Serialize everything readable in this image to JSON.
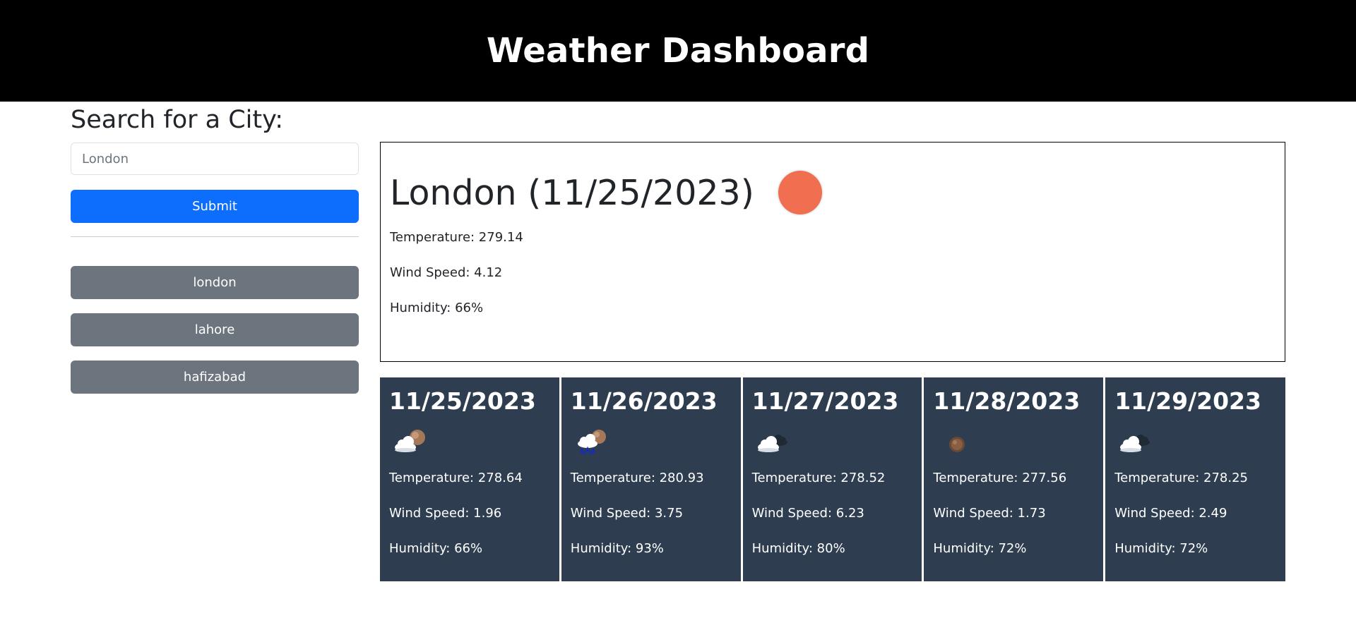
{
  "header": {
    "title": "Weather Dashboard"
  },
  "search": {
    "title": "Search for a City:",
    "value": "London",
    "placeholder": "London",
    "submit_label": "Submit"
  },
  "history": [
    {
      "label": "london"
    },
    {
      "label": "lahore"
    },
    {
      "label": "hafizabad"
    }
  ],
  "current": {
    "title": "London (11/25/2023)",
    "icon": "sun-icon",
    "temperature": "Temperature: 279.14",
    "wind": "Wind Speed: 4.12",
    "humidity": "Humidity: 66%"
  },
  "forecast": [
    {
      "date": "11/25/2023",
      "icon": "partly-cloudy-icon",
      "temperature": "Temperature: 278.64",
      "wind": "Wind Speed: 1.96",
      "humidity": "Humidity: 66%"
    },
    {
      "date": "11/26/2023",
      "icon": "rain-icon",
      "temperature": "Temperature: 280.93",
      "wind": "Wind Speed: 3.75",
      "humidity": "Humidity: 93%"
    },
    {
      "date": "11/27/2023",
      "icon": "broken-clouds-icon",
      "temperature": "Temperature: 278.52",
      "wind": "Wind Speed: 6.23",
      "humidity": "Humidity: 80%"
    },
    {
      "date": "11/28/2023",
      "icon": "clear-night-icon",
      "temperature": "Temperature: 277.56",
      "wind": "Wind Speed: 1.73",
      "humidity": "Humidity: 72%"
    },
    {
      "date": "11/29/2023",
      "icon": "broken-clouds-icon",
      "temperature": "Temperature: 278.25",
      "wind": "Wind Speed: 2.49",
      "humidity": "Humidity: 72%"
    }
  ],
  "colors": {
    "header_bg": "#000000",
    "primary": "#0d6efd",
    "secondary": "#6c757d",
    "card_bg": "#2e3e50",
    "sun": "#ef6f50"
  }
}
